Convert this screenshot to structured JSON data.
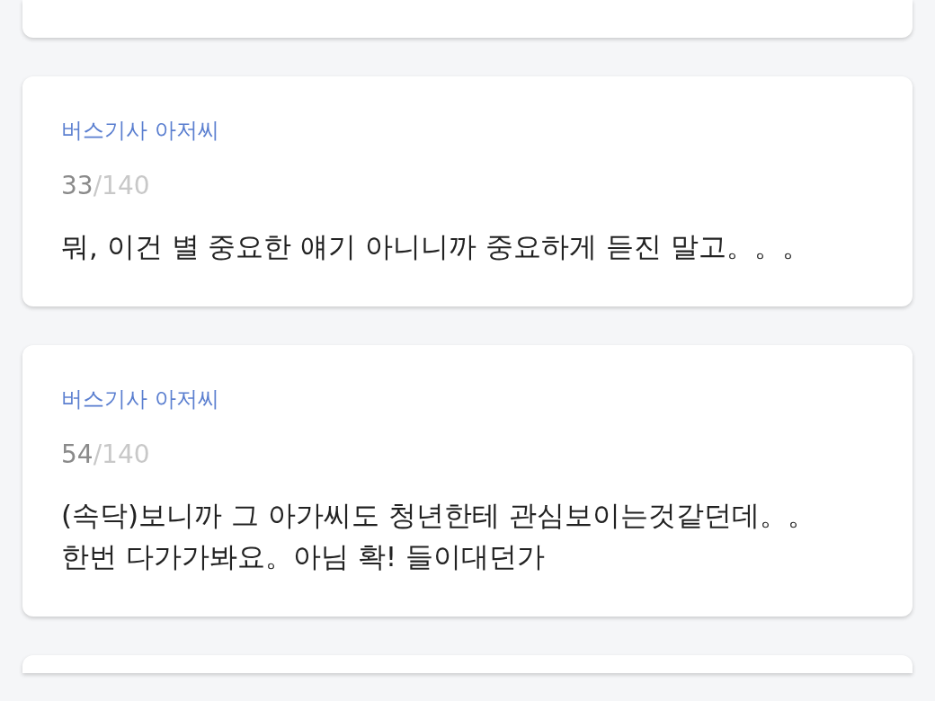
{
  "messages": [
    {
      "kind": "partial-top"
    },
    {
      "kind": "full",
      "speaker": "버스기사 아저씨",
      "count": "33",
      "limit": "/140",
      "text": "뭐, 이건 별 중요한 얘기 아니니까 중요하게 듣진 말고。。。"
    },
    {
      "kind": "full",
      "speaker": "버스기사 아저씨",
      "count": "54",
      "limit": "/140",
      "text": "(속닥)보니까 그 아가씨도 청년한테 관심보이는것같던데。。\n한번 다가가봐요。아님 확! 들이대던가"
    },
    {
      "kind": "partial-bottom"
    }
  ]
}
